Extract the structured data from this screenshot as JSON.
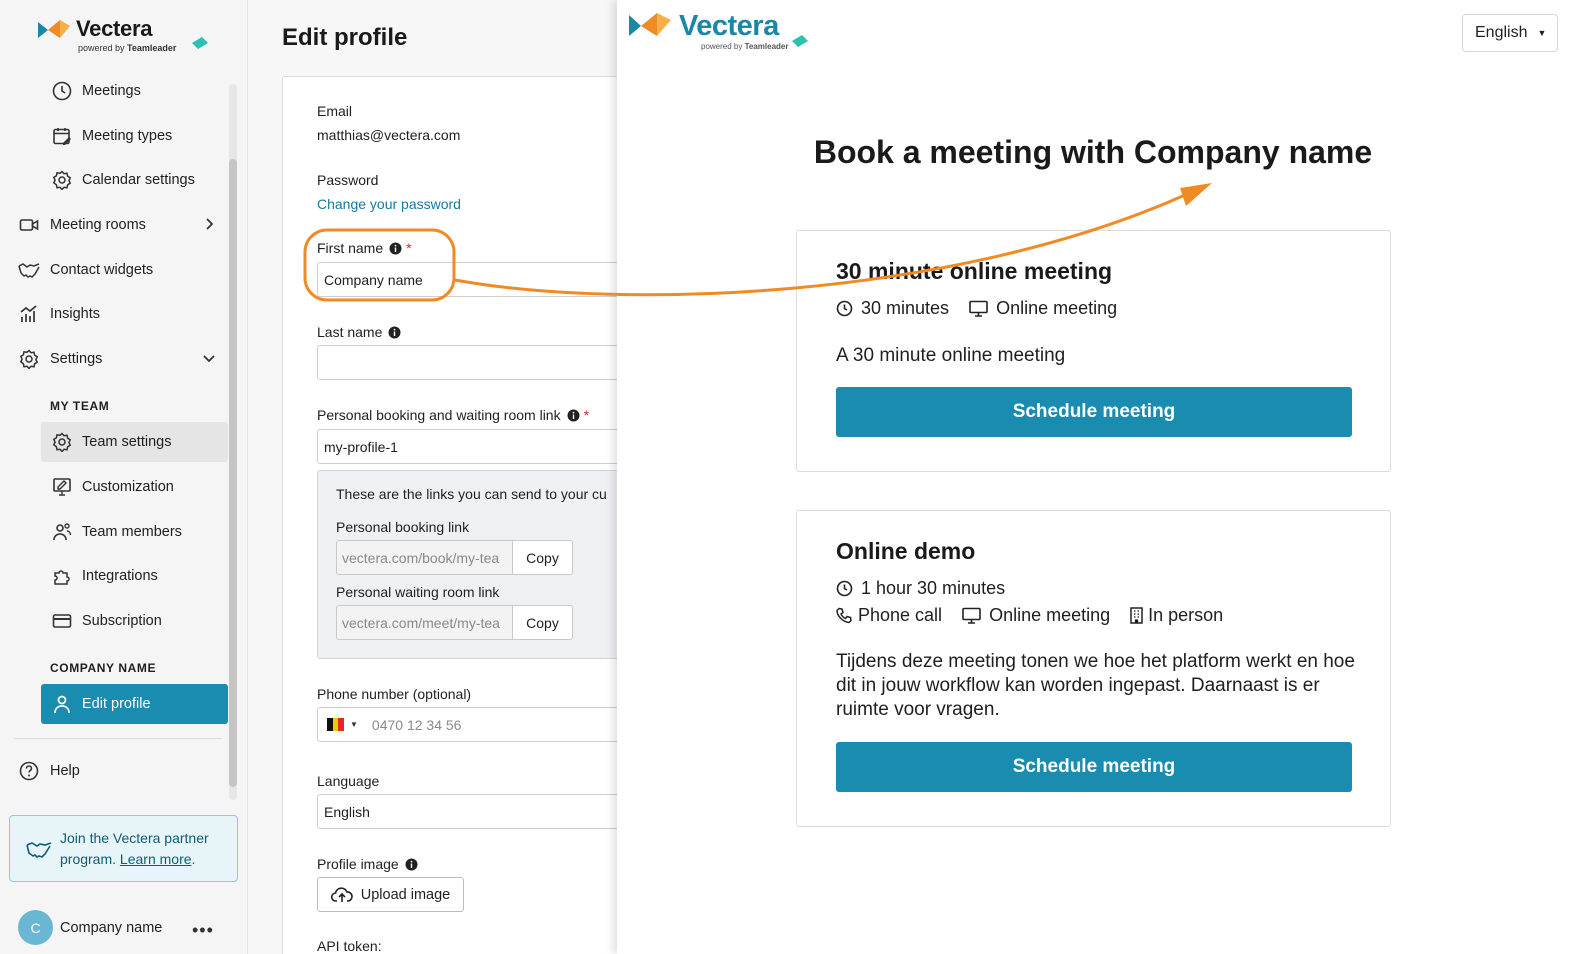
{
  "sidebar": {
    "brand": {
      "name": "Vectera",
      "powered": "powered by",
      "partner": "Teamleader"
    },
    "items": [
      {
        "label": "Meetings",
        "icon": "clock-icon"
      },
      {
        "label": "Meeting types",
        "icon": "calendar-edit-icon"
      },
      {
        "label": "Calendar settings",
        "icon": "gear-icon"
      },
      {
        "label": "Meeting rooms",
        "icon": "video-camera-icon"
      },
      {
        "label": "Contact widgets",
        "icon": "handshake-icon"
      },
      {
        "label": "Insights",
        "icon": "bar-chart-icon"
      },
      {
        "label": "Settings",
        "icon": "gear-icon"
      }
    ],
    "my_team_label": "MY TEAM",
    "team_items": [
      {
        "label": "Team settings",
        "icon": "gear-icon"
      },
      {
        "label": "Customization",
        "icon": "monitor-edit-icon"
      },
      {
        "label": "Team members",
        "icon": "users-icon"
      },
      {
        "label": "Integrations",
        "icon": "puzzle-icon"
      },
      {
        "label": "Subscription",
        "icon": "credit-card-icon"
      }
    ],
    "company_label": "COMPANY NAME",
    "company_items": [
      {
        "label": "Edit profile",
        "icon": "user-icon"
      }
    ],
    "help_label": "Help",
    "partner_text": "Join the Vectera partner program.",
    "partner_link": "Learn more",
    "partner_suffix": ".",
    "user": {
      "initial": "C",
      "name": "Company name",
      "more": "•••"
    }
  },
  "edit_profile": {
    "title": "Edit profile",
    "email_label": "Email",
    "email_value": "matthias@vectera.com",
    "password_label": "Password",
    "password_link": "Change your password",
    "first_name_label": "First name",
    "first_name_value": "Company name",
    "last_name_label": "Last name",
    "last_name_value": "",
    "booking_link_label": "Personal booking and waiting room link",
    "booking_link_value": "my-profile-1",
    "links_intro": "These are the links you can send to your cu",
    "personal_booking_label": "Personal booking link",
    "personal_booking_value": "vectera.com/book/my-tea",
    "personal_waiting_label": "Personal waiting room link",
    "personal_waiting_value": "vectera.com/meet/my-tea",
    "copy_label": "Copy",
    "phone_label": "Phone number (optional)",
    "phone_placeholder": "0470 12 34 56",
    "language_label": "Language",
    "language_value": "English",
    "profile_image_label": "Profile image",
    "upload_label": "Upload image",
    "api_token_label": "API token:",
    "required_mark": "*"
  },
  "preview": {
    "brand": {
      "name": "Vectera",
      "powered": "powered by",
      "partner": "Teamleader"
    },
    "language": "English",
    "headline": "Book a meeting with Company name",
    "meetings": [
      {
        "title": "30 minute online meeting",
        "duration": "30 minutes",
        "types": [
          "Online meeting"
        ],
        "description": "A 30 minute online meeting",
        "button": "Schedule meeting"
      },
      {
        "title": "Online demo",
        "duration": "1 hour 30 minutes",
        "types": [
          "Phone call",
          "Online meeting",
          "In person"
        ],
        "description": "Tijdens deze meeting tonen we hoe het platform werkt en hoe dit in jouw workflow kan worden ingepast. Daarnaast is er ruimte voor vragen.",
        "button": "Schedule meeting"
      }
    ]
  },
  "colors": {
    "accent": "#1a8caf",
    "annotation": "#f08a24",
    "required": "#d9232d",
    "link": "#1478a0"
  }
}
